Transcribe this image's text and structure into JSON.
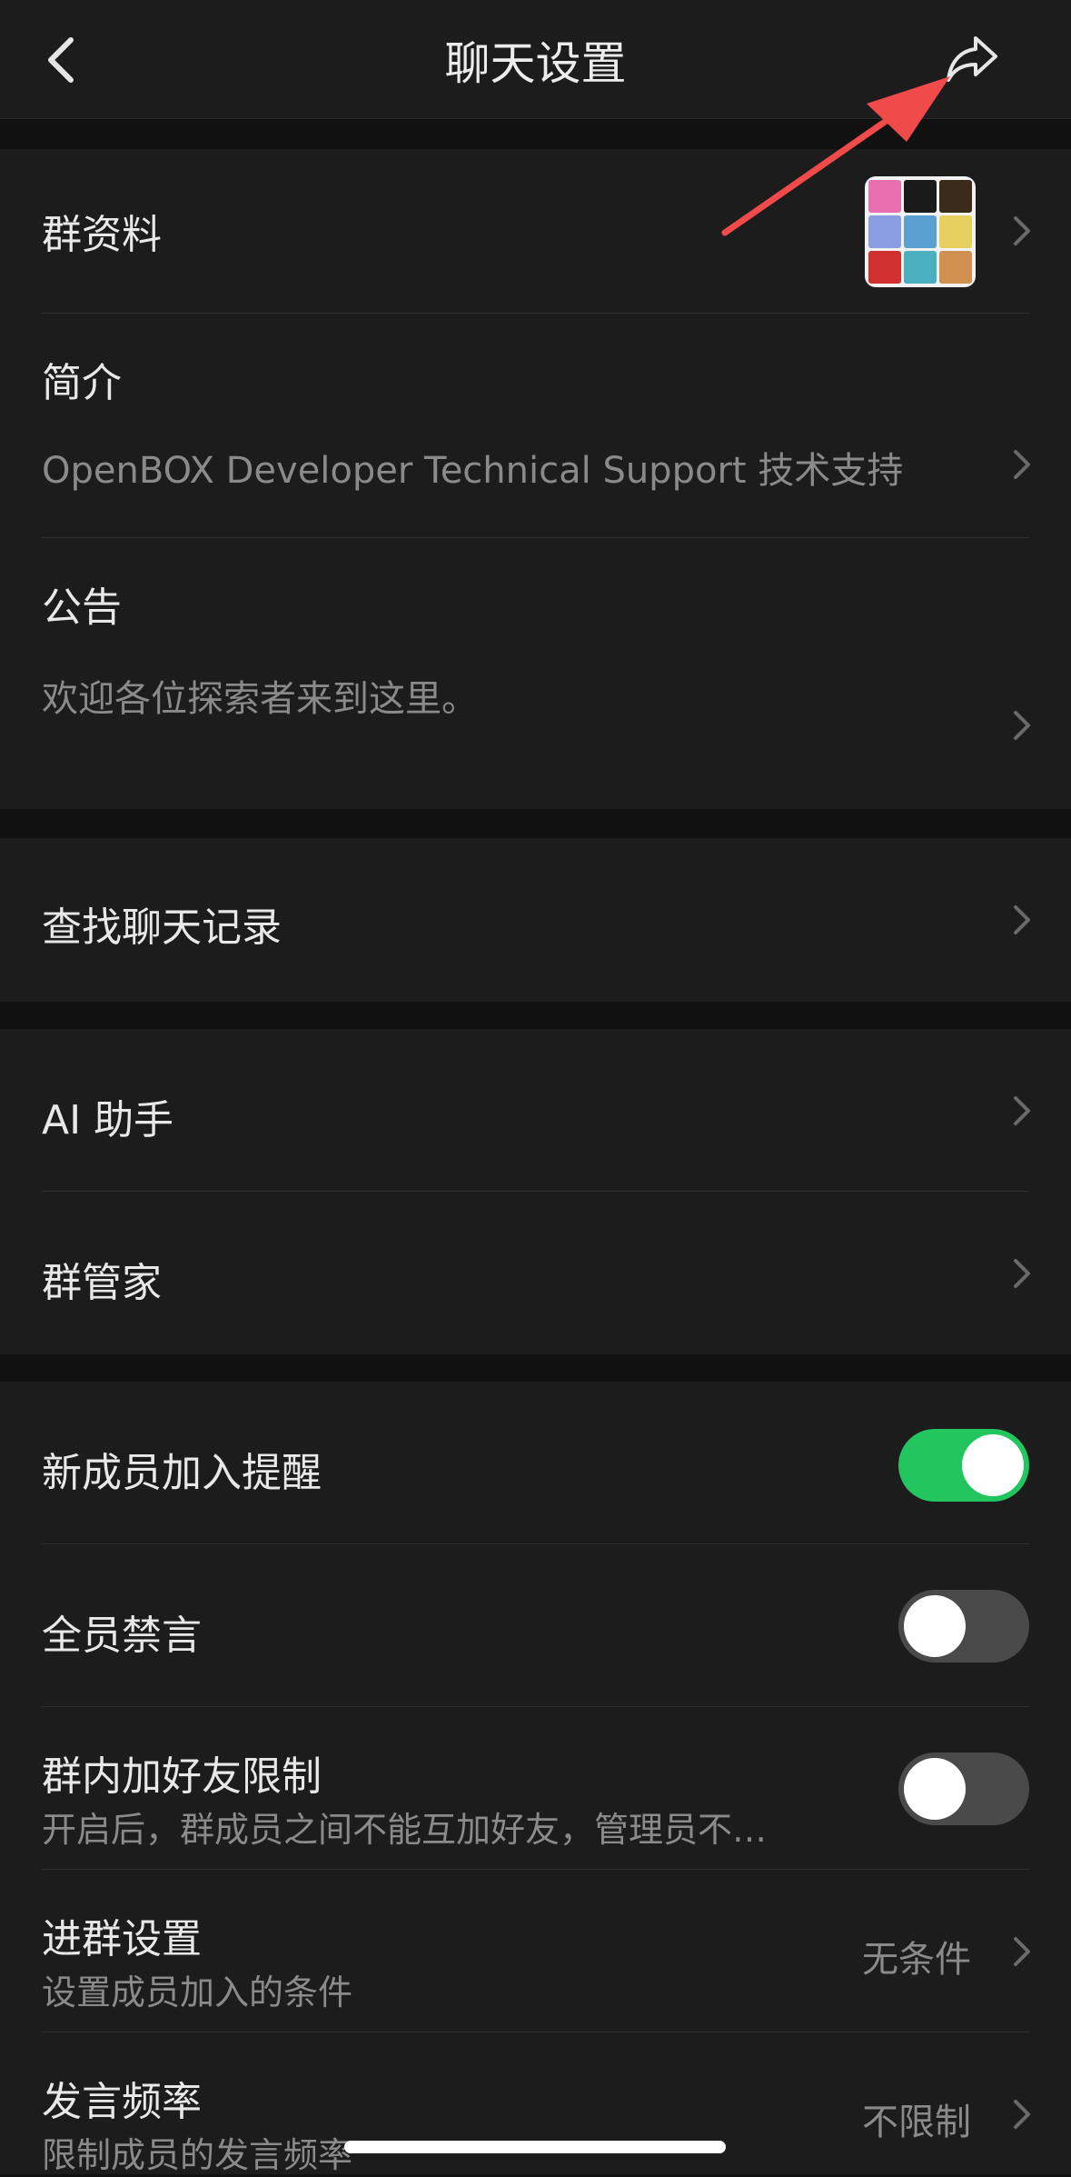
{
  "nav": {
    "title": "聊天设置",
    "back_icon": "chevron-left-icon",
    "share_icon": "share-icon"
  },
  "annotation": {
    "arrow_color": "#f04a4a"
  },
  "group_profile": {
    "label": "群资料",
    "avatar_colors": [
      "#e86fb0",
      "#1a1a1a",
      "#3a2a1a",
      "#8a9de0",
      "#5aa0d0",
      "#e8d060",
      "#d03030",
      "#4ab0c0",
      "#d09050"
    ]
  },
  "intro": {
    "label": "简介",
    "text": "OpenBOX Developer Technical Support 技术支持"
  },
  "notice": {
    "label": "公告",
    "text": "欢迎各位探索者来到这里。"
  },
  "search_history": {
    "label": "查找聊天记录"
  },
  "ai_assistant": {
    "label": "AI 助手"
  },
  "group_manager": {
    "label": "群管家"
  },
  "new_member_alert": {
    "label": "新成员加入提醒",
    "enabled": true
  },
  "mute_all": {
    "label": "全员禁言",
    "enabled": false
  },
  "friend_limit": {
    "label": "群内加好友限制",
    "desc": "开启后，群成员之间不能互加好友，管理员不…",
    "enabled": false
  },
  "join_settings": {
    "label": "进群设置",
    "desc": "设置成员加入的条件",
    "value": "无条件"
  },
  "speak_rate": {
    "label": "发言频率",
    "desc": "限制成员的发言频率",
    "value": "不限制"
  },
  "colors": {
    "toggle_on": "#22c55e",
    "toggle_off": "#4a4a4a",
    "background": "#111111",
    "cell": "#1c1c1c"
  }
}
